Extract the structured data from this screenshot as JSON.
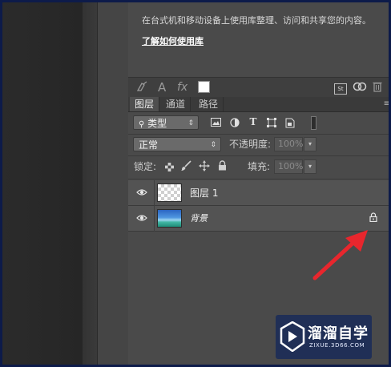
{
  "library": {
    "description": "在台式机和移动设备上使用库整理、访问和共享您的内容。",
    "link_text": "了解如何使用库"
  },
  "library_toolbar": {
    "icons": [
      "brush-stamp-icon",
      "type-text-icon",
      "fx-effects-icon",
      "color-swatch-white",
      "stock-icon",
      "creative-cloud-icon",
      "trash-icon"
    ],
    "text_icon": "A",
    "fx_icon": "fx",
    "stock_icon": "St"
  },
  "tabs": [
    "图层",
    "通道",
    "路径"
  ],
  "active_tab": "图层",
  "filter": {
    "kind_label": "类型",
    "icons": [
      "image-filter-icon",
      "adjustment-filter-icon",
      "type-filter-icon",
      "shape-filter-icon",
      "smart-object-filter-icon",
      "filter-toggle-icon"
    ]
  },
  "blend": {
    "mode": "正常",
    "opacity_label": "不透明度:",
    "opacity_value": "100%"
  },
  "lock": {
    "label": "锁定:",
    "icons": [
      "lock-transparent-icon",
      "lock-paint-icon",
      "lock-position-icon",
      "lock-all-icon"
    ],
    "fill_label": "填充:",
    "fill_value": "100%"
  },
  "layers": [
    {
      "name": "图层 1",
      "visible": true,
      "thumbnail": "transparent",
      "locked": false
    },
    {
      "name": "背景",
      "visible": true,
      "thumbnail": "landscape",
      "locked": true
    }
  ],
  "annotation": {
    "color": "#e8262d",
    "points_to": "background-layer-lock-icon"
  },
  "watermark": {
    "title": "溜溜自学",
    "url": "ZIXUE.3D66.COM"
  }
}
